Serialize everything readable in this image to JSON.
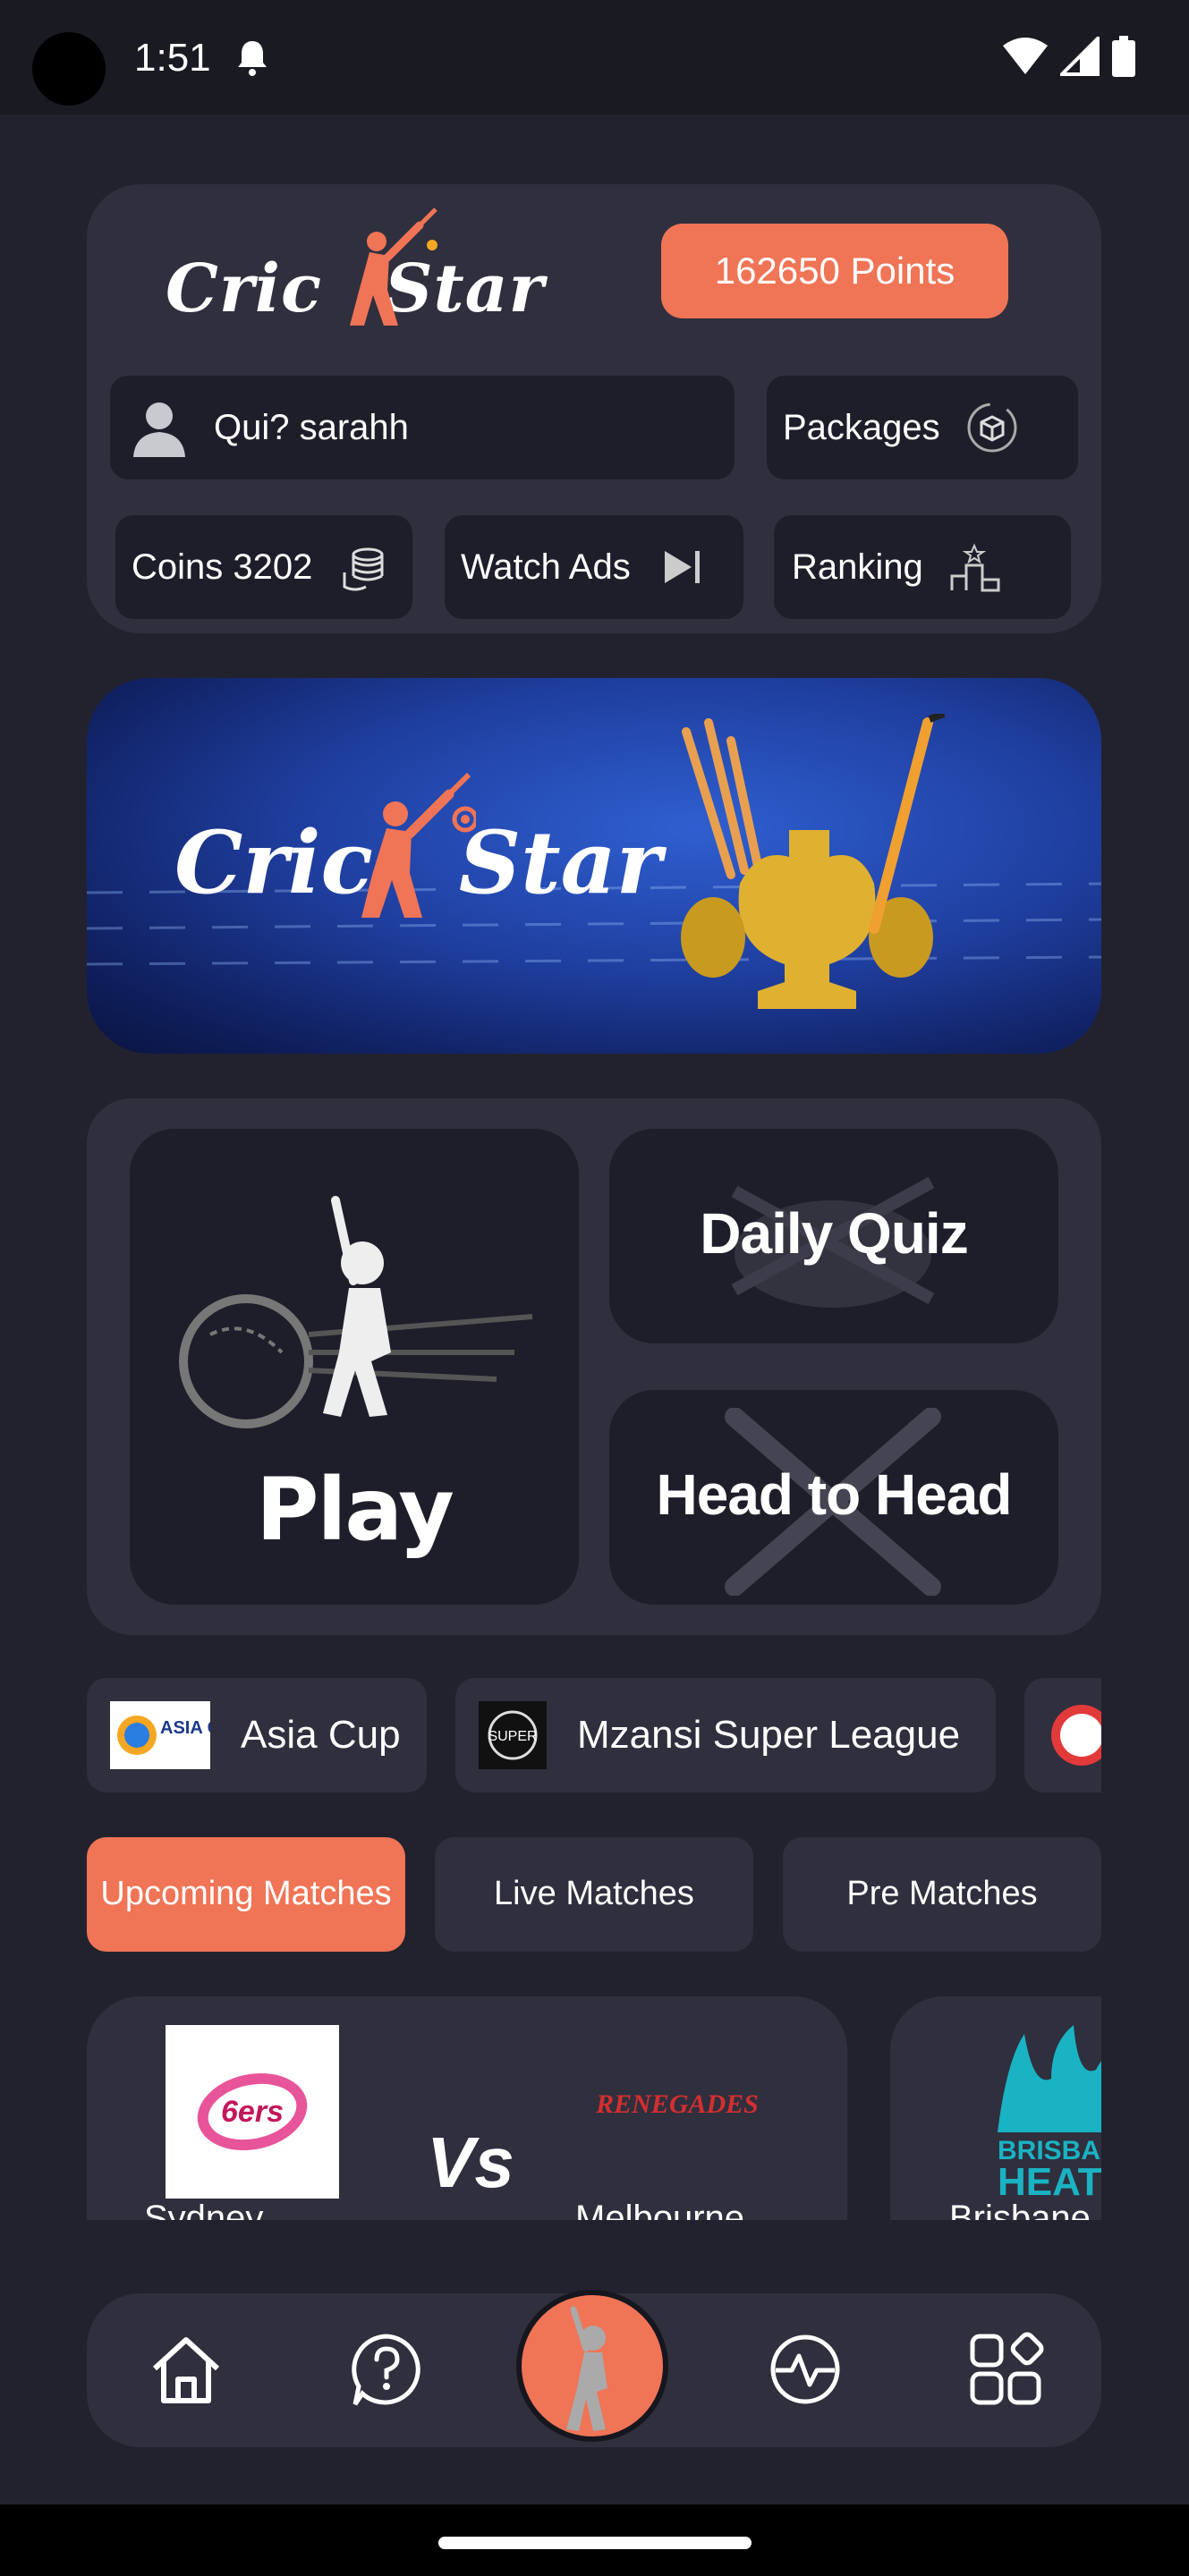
{
  "status_bar": {
    "time": "1:51"
  },
  "header": {
    "logo_text_1": "Cric",
    "logo_text_2": "Star",
    "points": "162650 Points",
    "user_label": "Qui? sarahh",
    "packages_label": "Packages",
    "coins_label": "Coins 3202",
    "watch_ads_label": "Watch Ads",
    "ranking_label": "Ranking"
  },
  "banner": {
    "logo_text_1": "Cric",
    "logo_text_2": "Star"
  },
  "modes": {
    "play": "Play",
    "daily_quiz": "Daily Quiz",
    "head_to_head": "Head to Head"
  },
  "leagues": [
    {
      "name": "Asia Cup",
      "logo_text": "ASIA CUP"
    },
    {
      "name": "Mzansi Super League",
      "logo_text": "SUPER"
    }
  ],
  "tabs": [
    {
      "label": "Upcoming Matches",
      "active": true
    },
    {
      "label": "Live Matches",
      "active": false
    },
    {
      "label": "Pre Matches",
      "active": false
    }
  ],
  "matches": [
    {
      "team1": "Sydney",
      "team1_logo_text": "6ers",
      "vs": "Vs",
      "team2": "Melbourne",
      "team2_logo_text": "RENEGADES"
    },
    {
      "team1": "Brisbane",
      "team1_logo_text": "BRISBANE HEAT"
    }
  ],
  "colors": {
    "accent": "#f07456",
    "background": "#22222f",
    "card": "#2f2f3e",
    "button": "#1e1e2a"
  },
  "nav_icons": [
    "home-icon",
    "help-icon",
    "batsman-icon",
    "activity-icon",
    "apps-icon"
  ]
}
